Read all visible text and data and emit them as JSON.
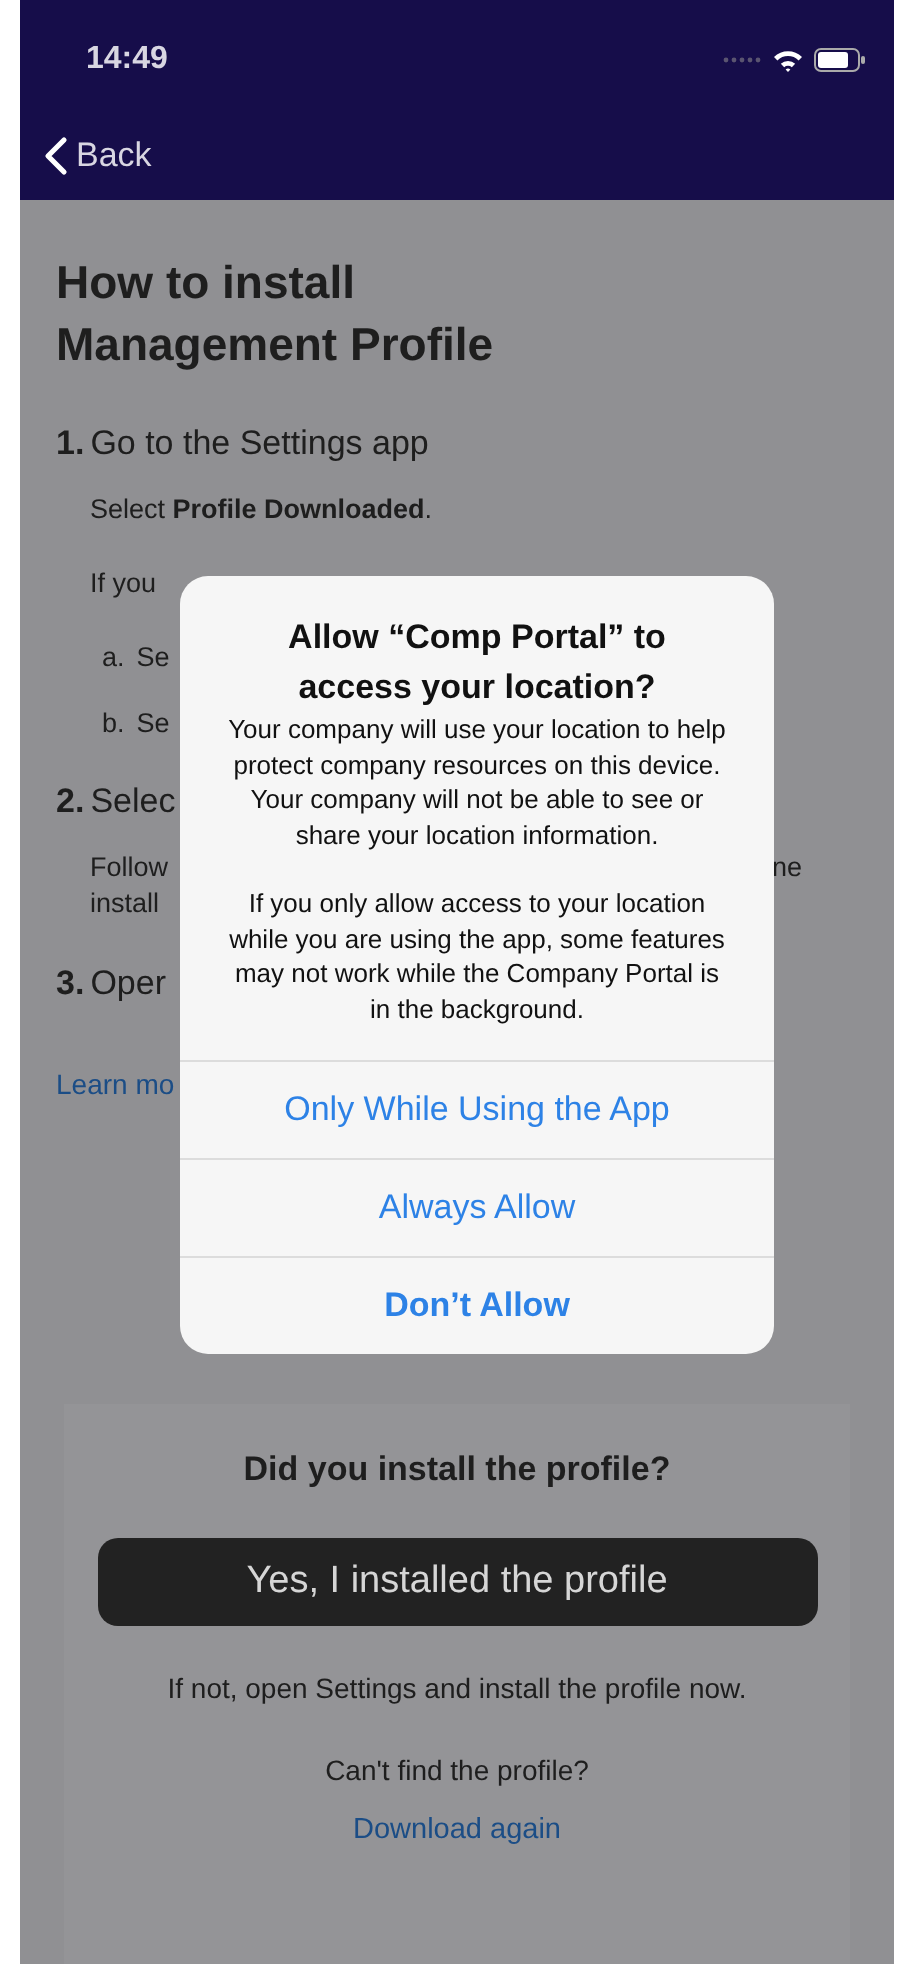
{
  "status_bar": {
    "time": "14:49"
  },
  "nav": {
    "back_label": "Back"
  },
  "title": "How to install Management Profile",
  "steps": [
    {
      "number": "1.",
      "text": "Go to the Settings app",
      "details": [
        {
          "kind": "text",
          "text": "Select **Profile Downloaded**."
        },
        {
          "kind": "text",
          "text": "If you"
        },
        {
          "kind": "list",
          "marker": "a.",
          "text": "Se"
        },
        {
          "kind": "list",
          "marker": "b.",
          "text": "Se"
        }
      ]
    },
    {
      "number": "2.",
      "text": "Selec",
      "details": [
        {
          "kind": "split",
          "left": "Follow",
          "right": "ne"
        },
        {
          "kind": "text",
          "text": "install"
        }
      ]
    },
    {
      "number": "3.",
      "text": "Oper"
    }
  ],
  "learn_more": "Learn mo",
  "dialog": {
    "title": "Allow “Comp Portal” to access your location?",
    "messages": [
      "Your company will use your location to help protect company resources on this device. Your company will not be able to see or share your location information.",
      "If you only allow access to your location while you are using the app, some features may not work while the Company Portal is in the background."
    ],
    "buttons": [
      {
        "label": "Only While Using the App",
        "bold": false
      },
      {
        "label": "Always Allow",
        "bold": false
      },
      {
        "label": "Don’t Allow",
        "bold": true
      }
    ]
  },
  "footer": {
    "question": "Did you install the profile?",
    "primary_button": "Yes, I installed the profile",
    "hint": "If not, open Settings and install the profile now.",
    "sub_question": "Can't find the profile?",
    "link": "Download again"
  }
}
